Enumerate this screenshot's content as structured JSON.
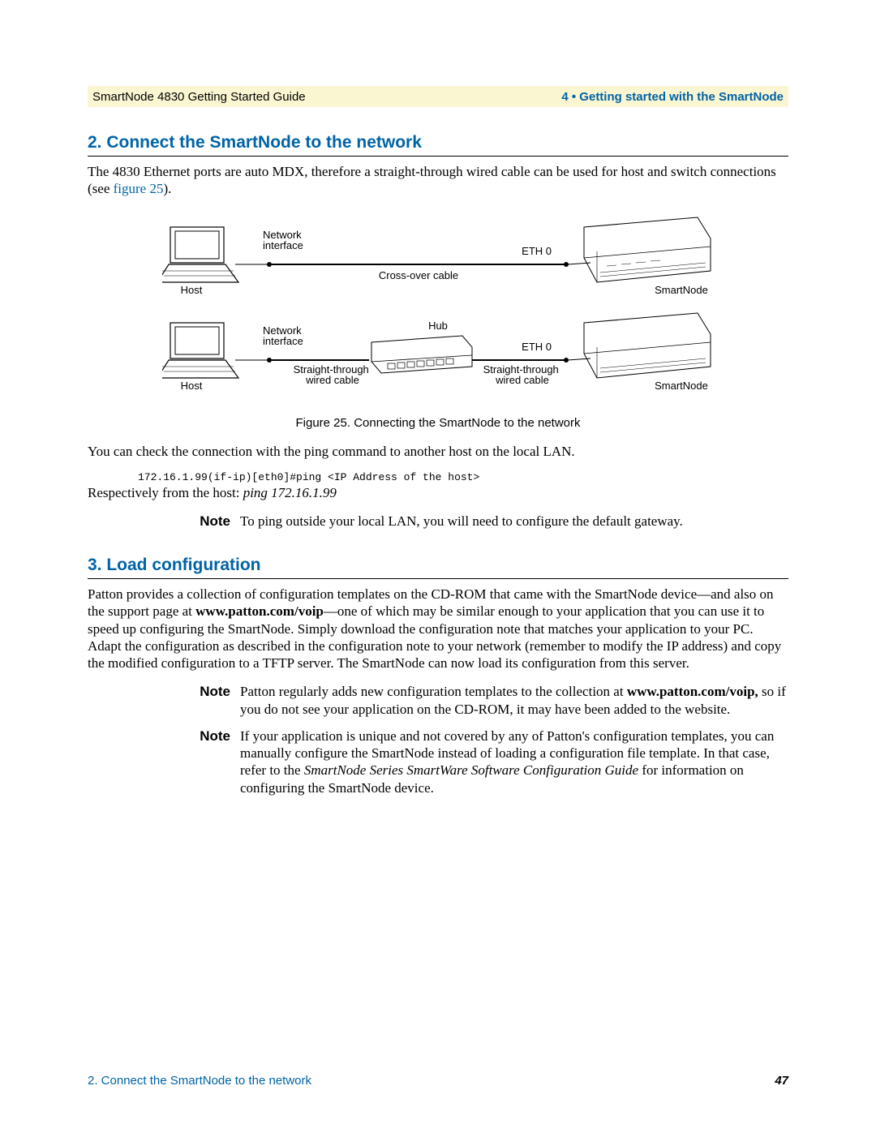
{
  "header": {
    "left": "SmartNode 4830 Getting Started Guide",
    "right": "4 • Getting started with the SmartNode"
  },
  "section2": {
    "heading": "2. Connect the SmartNode to the network",
    "para_before": "The 4830 Ethernet ports are auto MDX, therefore a straight-through wired cable can be used for host and switch connections (see ",
    "figure_link": "figure 25",
    "para_after_link": ").",
    "figure_caption": "Figure 25. Connecting the SmartNode to the network",
    "para2": "You can check the connection with the ping command to another host on the local LAN.",
    "code_line": "172.16.1.99(if-ip)[eth0]#ping <IP Address of the host>",
    "resp_from_host_prefix": "Respectively from the host: ",
    "resp_from_host_cmd": "ping 172.16.1.99",
    "note1": "To ping outside your local LAN, you will need to configure the default gateway.",
    "diagram": {
      "top": {
        "host": "Host",
        "network_interface": "Network\ninterface",
        "cable": "Cross-over cable",
        "eth": "ETH 0",
        "device": "SmartNode"
      },
      "bottom": {
        "host": "Host",
        "network_interface": "Network\ninterface",
        "left_cable": "Straight-through\nwired cable",
        "hub": "Hub",
        "right_cable": "Straight-through\nwired cable",
        "eth": "ETH 0",
        "device": "SmartNode"
      }
    }
  },
  "section3": {
    "heading": "3. Load configuration",
    "para1_a": "Patton provides a collection of configuration templates on the CD-ROM that came with the SmartNode device—and also on the support page at ",
    "url1": "www.patton.com/voip",
    "para1_b": "—one of which may be similar enough to your application that you can use it to speed up configuring the SmartNode. Simply download the configuration note that matches your application to your PC. Adapt the configuration as described in the configuration note to your network (remember to modify the IP address) and copy the modified configuration to a TFTP server. The SmartNode can now load its configuration from this server.",
    "note1_a": "Patton regularly adds new configuration templates to the collection at ",
    "note1_url": "www.patton.com/voip,",
    "note1_b": " so if you do not see your application on the CD-ROM, it may have been added to the website.",
    "note2_a": "If your application is unique and not covered by any of Patton's configuration templates, you can manually configure the SmartNode instead of loading a configuration file template. In that case, refer to the ",
    "note2_i": "SmartNode Series SmartWare Software Configuration Guide",
    "note2_b": " for information on configuring the SmartNode device."
  },
  "note_label": "Note",
  "footer": {
    "left": "2. Connect the SmartNode to the network",
    "page": "47"
  }
}
